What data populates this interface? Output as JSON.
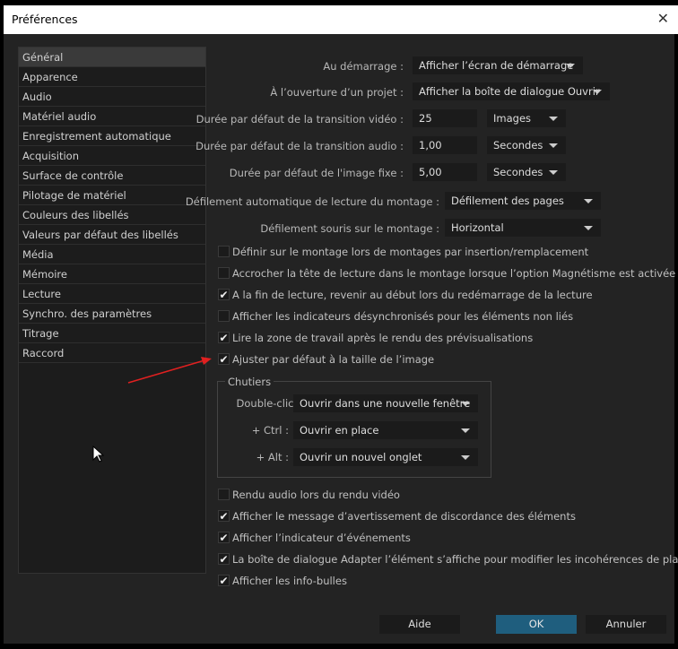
{
  "window": {
    "title": "Préférences",
    "close": "✕"
  },
  "sidebar": {
    "items": [
      "Général",
      "Apparence",
      "Audio",
      "Matériel audio",
      "Enregistrement automatique",
      "Acquisition",
      "Surface de contrôle",
      "Pilotage de matériel",
      "Couleurs des libellés",
      "Valeurs par défaut des libellés",
      "Média",
      "Mémoire",
      "Lecture",
      "Synchro. des paramètres",
      "Titrage",
      "Raccord"
    ],
    "selected": "Général"
  },
  "settings": {
    "startup": {
      "label": "Au démarrage :",
      "value": "Afficher l’écran de démarrage"
    },
    "open_project": {
      "label": "À l’ouverture d’un projet :",
      "value": "Afficher la boîte de dialogue Ouvrir"
    },
    "video_transition": {
      "label": "Durée par défaut de la transition vidéo :",
      "value": "25",
      "unit": "Images"
    },
    "audio_transition": {
      "label": "Durée par défaut de la transition audio :",
      "value": "1,00",
      "unit": "Secondes"
    },
    "still_image": {
      "label": "Durée par défaut de l'image fixe :",
      "value": "5,00",
      "unit": "Secondes"
    },
    "auto_scroll": {
      "label": "Défilement automatique de lecture du montage :",
      "value": "Défilement des pages"
    },
    "mouse_scroll": {
      "label": "Défilement souris sur le montage :",
      "value": "Horizontal"
    }
  },
  "checkboxes1": [
    {
      "label": "Définir sur le montage lors de montages par insertion/remplacement",
      "checked": false
    },
    {
      "label": "Accrocher la tête de lecture dans le montage lorsque l’option Magnétisme est activée",
      "checked": false
    },
    {
      "label": "A la fin de lecture, revenir au début lors du redémarrage de la lecture",
      "checked": true
    },
    {
      "label": "Afficher les indicateurs désynchronisés pour les éléments non liés",
      "checked": false
    },
    {
      "label": "Lire la zone de travail après le rendu des prévisualisations",
      "checked": true
    },
    {
      "label": "Ajuster par défaut à la taille de l’image",
      "checked": true
    }
  ],
  "bins": {
    "title": "Chutiers",
    "double_click": {
      "label": "Double-clic :",
      "value": "Ouvrir dans une nouvelle fenêtre"
    },
    "ctrl": {
      "label": "+ Ctrl :",
      "value": "Ouvrir en place"
    },
    "alt": {
      "label": "+ Alt :",
      "value": "Ouvrir un nouvel onglet"
    }
  },
  "checkboxes2": [
    {
      "label": "Rendu audio lors du rendu vidéo",
      "checked": false
    },
    {
      "label": "Afficher le message d’avertissement de discordance des éléments",
      "checked": true
    },
    {
      "label": "Afficher l’indicateur d’événements",
      "checked": true
    },
    {
      "label": "La boîte de dialogue Adapter l’élément s’affiche pour modifier les incohérences de plage",
      "checked": true
    },
    {
      "label": "Afficher les info-bulles",
      "checked": true
    }
  ],
  "buttons": {
    "help": "Aide",
    "ok": "OK",
    "cancel": "Annuler"
  },
  "colors": {
    "accent": "#1f5e7e",
    "annotation_arrow": "#e02020"
  }
}
